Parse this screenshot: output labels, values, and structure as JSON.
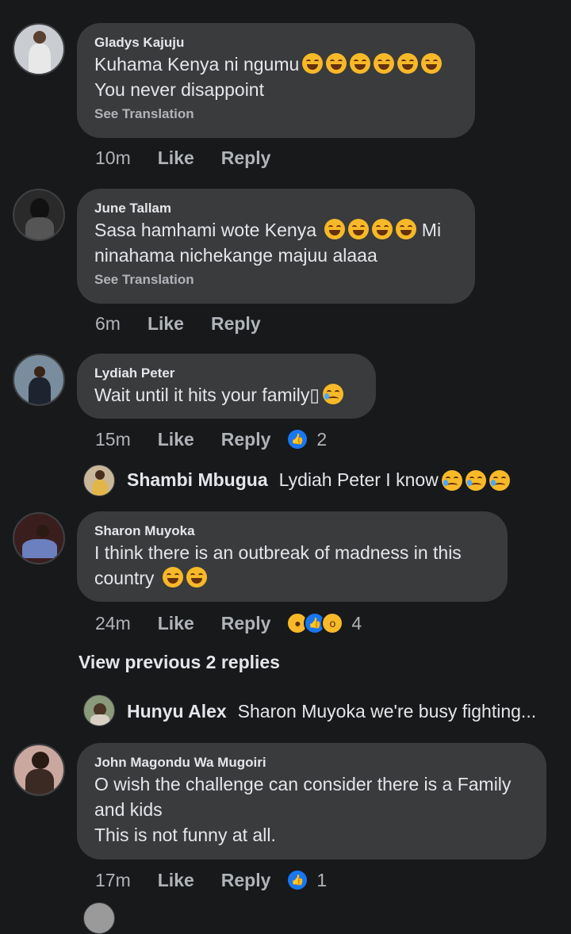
{
  "comments": [
    {
      "author": "Gladys Kajuju",
      "line1": "Kuhama Kenya ni ngumu",
      "line2": "You never disappoint",
      "see_translation": "See Translation",
      "time": "10m",
      "like": "Like",
      "reply": "Reply"
    },
    {
      "author": "June Tallam",
      "line1": "Sasa hamhami wote Kenya",
      "line1_end": "Mi",
      "line2": "ninahama nichekange majuu alaaa",
      "see_translation": "See Translation",
      "time": "6m",
      "like": "Like",
      "reply": "Reply"
    },
    {
      "author": "Lydiah Peter",
      "line1": "Wait until it hits your family▯",
      "time": "15m",
      "like": "Like",
      "reply": "Reply",
      "reaction_count": "2",
      "reply_author": "Shambi Mbugua",
      "reply_text": "Lydiah Peter I know"
    },
    {
      "author": "Sharon Muyoka",
      "line1": "I think there is an  outbreak of madness  in this",
      "line2": "country",
      "time": "24m",
      "like": "Like",
      "reply": "Reply",
      "reaction_count": "4",
      "view_previous": "View previous 2 replies",
      "reply_author": "Hunyu Alex",
      "reply_text": "Sharon Muyoka we're busy fighting..."
    },
    {
      "author": "John Magondu Wa Mugoiri",
      "line1": "O wish the challenge can consider there is a Family",
      "line2": "and kids",
      "line3": "This is not funny at all.",
      "time": "17m",
      "like": "Like",
      "reply": "Reply",
      "reaction_count": "1"
    }
  ],
  "colors": {
    "background": "#18191a",
    "bubble": "#3a3b3c",
    "text": "#e4e6eb",
    "secondary_text": "#b0b3b8",
    "like_blue": "#1877f2",
    "emoji_yellow": "#f7b928"
  }
}
